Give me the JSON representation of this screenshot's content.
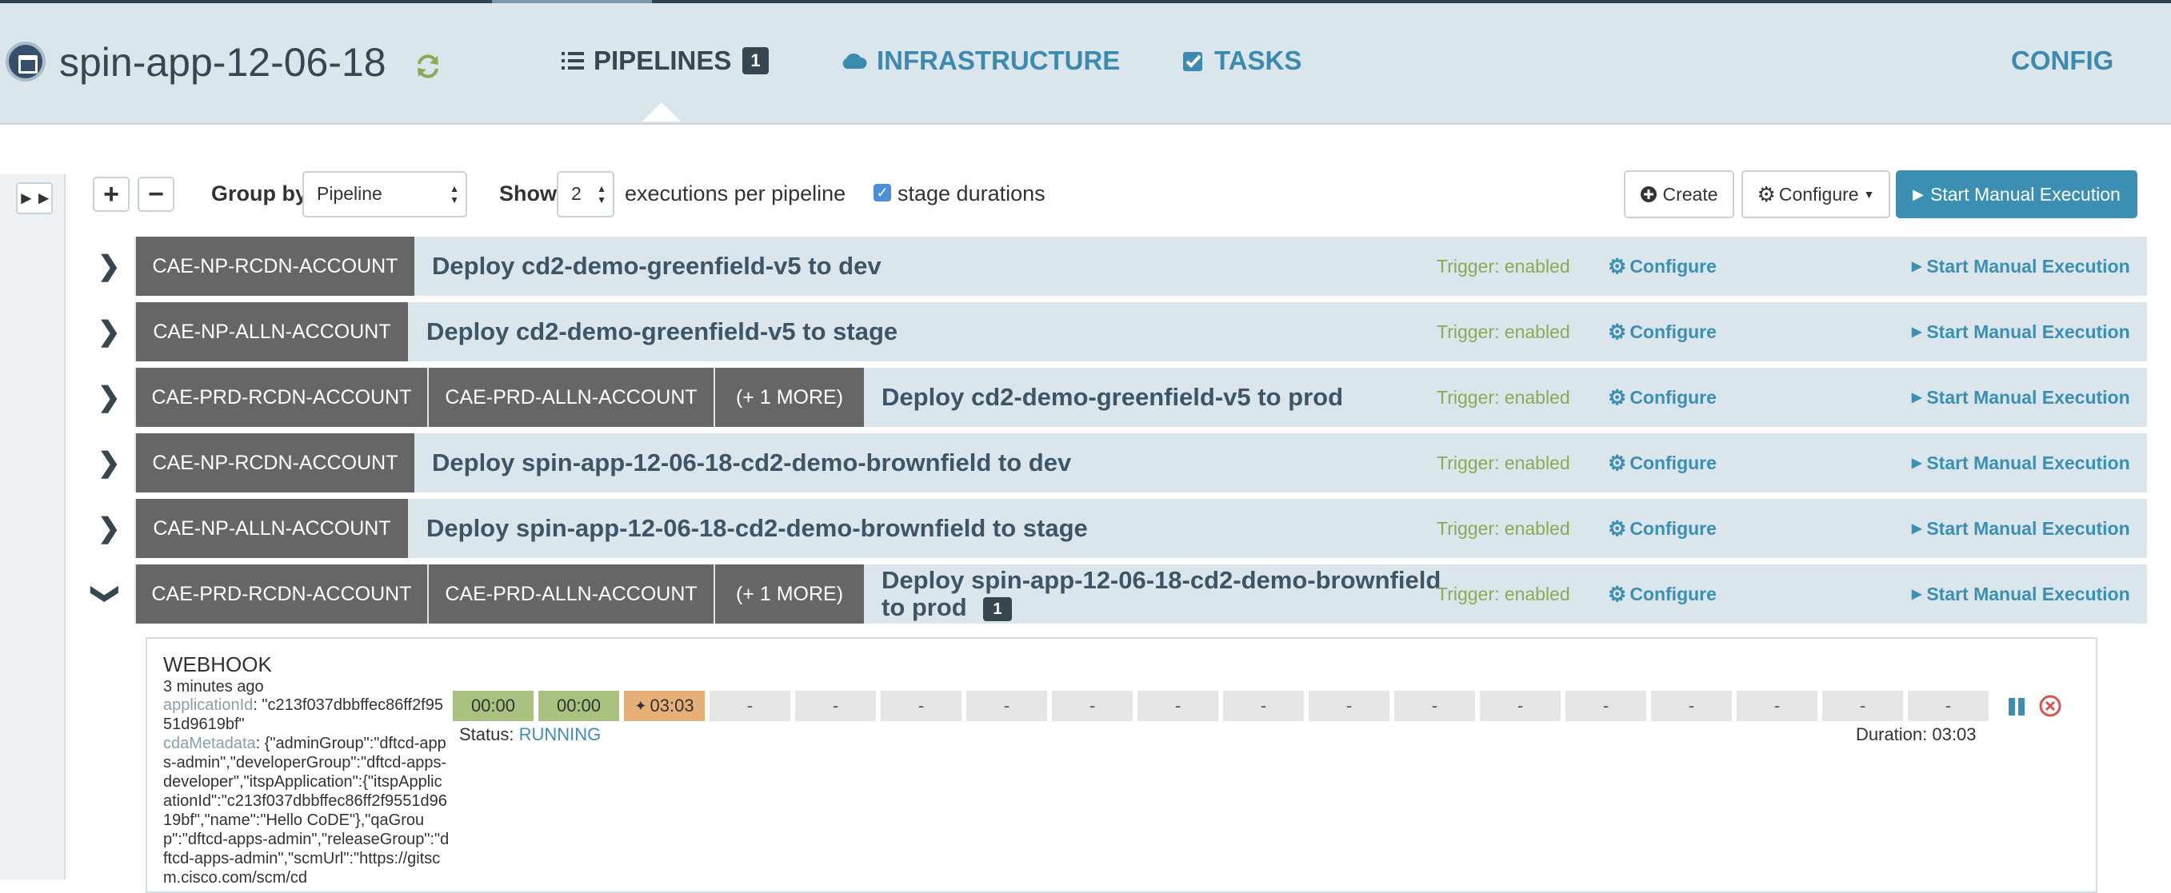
{
  "app": {
    "title": "spin-app-12-06-18"
  },
  "nav": {
    "pipelines_label": "PIPELINES",
    "pipelines_badge": "1",
    "infrastructure_label": "INFRASTRUCTURE",
    "tasks_label": "TASKS",
    "config_label": "CONFIG"
  },
  "toolbar": {
    "group_by_label": "Group by",
    "group_by_value": "Pipeline",
    "show_label": "Show",
    "show_value": "2",
    "executions_label": "executions per pipeline",
    "stage_durations_label": "stage durations",
    "stage_durations_checked": true,
    "create_label": "Create",
    "configure_label": "Configure",
    "start_label": "Start Manual Execution"
  },
  "pipelines": [
    {
      "accounts": [
        "CAE-NP-RCDN-ACCOUNT"
      ],
      "name": "Deploy cd2-demo-greenfield-v5 to dev",
      "trigger": "Trigger: enabled",
      "configure": "Configure",
      "start": "Start Manual Execution"
    },
    {
      "accounts": [
        "CAE-NP-ALLN-ACCOUNT"
      ],
      "name": "Deploy cd2-demo-greenfield-v5 to stage",
      "trigger": "Trigger: enabled",
      "configure": "Configure",
      "start": "Start Manual Execution"
    },
    {
      "accounts": [
        "CAE-PRD-RCDN-ACCOUNT",
        "CAE-PRD-ALLN-ACCOUNT",
        "(+ 1 MORE)"
      ],
      "name": "Deploy cd2-demo-greenfield-v5 to prod",
      "trigger": "Trigger: enabled",
      "configure": "Configure",
      "start": "Start Manual Execution"
    },
    {
      "accounts": [
        "CAE-NP-RCDN-ACCOUNT"
      ],
      "name": "Deploy spin-app-12-06-18-cd2-demo-brownfield to dev",
      "trigger": "Trigger: enabled",
      "configure": "Configure",
      "start": "Start Manual Execution"
    },
    {
      "accounts": [
        "CAE-NP-ALLN-ACCOUNT"
      ],
      "name": "Deploy spin-app-12-06-18-cd2-demo-brownfield to stage",
      "trigger": "Trigger: enabled",
      "configure": "Configure",
      "start": "Start Manual Execution"
    },
    {
      "accounts": [
        "CAE-PRD-RCDN-ACCOUNT",
        "CAE-PRD-ALLN-ACCOUNT",
        "(+ 1 MORE)"
      ],
      "name": "Deploy spin-app-12-06-18-cd2-demo-brownfield to prod",
      "badge": "1",
      "trigger": "Trigger: enabled",
      "configure": "Configure",
      "start": "Start Manual Execution"
    }
  ],
  "execution": {
    "trigger_type": "WEBHOOK",
    "time_ago": "3 minutes ago",
    "param1_key": "applicationId",
    "param1_value": ": \"c213f037dbbffec86ff2f9551d9619bf\"",
    "param2_key": "cdaMetadata",
    "param2_value": ": {\"adminGroup\":\"dftcd-apps-admin\",\"developerGroup\":\"dftcd-apps-developer\",\"itspApplication\":{\"itspApplicationId\":\"c213f037dbbffec86ff2f9551d9619bf\",\"name\":\"Hello CoDE\"},\"qaGroup\":\"dftcd-apps-admin\",\"releaseGroup\":\"dftcd-apps-admin\",\"scmUrl\":\"https://gitscm.cisco.com/scm/cd",
    "stages": [
      "00:00",
      "00:00",
      "03:03",
      "-",
      "-",
      "-",
      "-",
      "-",
      "-",
      "-",
      "-",
      "-",
      "-",
      "-",
      "-",
      "-",
      "-",
      "-"
    ],
    "stage_states": [
      "ok",
      "ok",
      "run",
      "none",
      "none",
      "none",
      "none",
      "none",
      "none",
      "none",
      "none",
      "none",
      "none",
      "none",
      "none",
      "none",
      "none",
      "none"
    ],
    "status_label": "Status:",
    "status_value": "RUNNING",
    "duration": "Duration: 03:03"
  },
  "colors": {
    "header_bg": "#dbe6ec",
    "accent": "#3a8fb3",
    "account_chip": "#666666",
    "trigger_green": "#8aab53",
    "stage_success": "#a9c27f",
    "stage_running": "#e7b079"
  },
  "icons": {
    "app": "window-icon",
    "refresh": "refresh-icon",
    "pipelines": "list-icon",
    "infrastructure": "cloud-icon",
    "tasks": "check-square-icon",
    "expand": "double-chevron-right-icon",
    "configure": "gear-icon",
    "start": "play-icon",
    "pause": "pause-icon",
    "cancel": "cancel-icon"
  }
}
